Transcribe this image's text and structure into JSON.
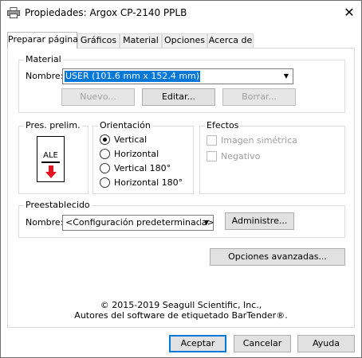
{
  "window": {
    "title": "Propiedades: Argox CP-2140 PPLB",
    "close_glyph": "✕"
  },
  "tabs": [
    {
      "label": "Preparar página"
    },
    {
      "label": "Gráficos"
    },
    {
      "label": "Material"
    },
    {
      "label": "Opciones"
    },
    {
      "label": "Acerca de"
    }
  ],
  "material": {
    "legend": "Material",
    "nombre_label": "Nombre:",
    "selected": "USER (101.6 mm x 152.4 mm)",
    "nuevo": "Nuevo...",
    "editar": "Editar...",
    "borrar": "Borrar..."
  },
  "preview": {
    "legend": "Pres. prelim.",
    "label_text": "ALE"
  },
  "orientacion": {
    "legend": "Orientación",
    "options": [
      "Vertical",
      "Horizontal",
      "Vertical 180°",
      "Horizontal 180°"
    ],
    "selected_index": 0
  },
  "efectos": {
    "legend": "Efectos",
    "options": [
      "Imagen simétrica",
      "Negativo"
    ]
  },
  "preestablecido": {
    "legend": "Preestablecido",
    "nombre_label": "Nombre:",
    "selected": "<Configuración predeterminada>",
    "administre": "Administre..."
  },
  "opciones_avanzadas": "Opciones avanzadas...",
  "copyright": {
    "line1": "© 2015-2019 Seagull Scientific, Inc.,",
    "line2": "Autores del software de etiquetado BarTender®."
  },
  "footer": {
    "aceptar": "Aceptar",
    "cancelar": "Cancelar",
    "ayuda": "Ayuda"
  },
  "colors": {
    "accent": "#0078d7",
    "arrow": "#e81123"
  }
}
